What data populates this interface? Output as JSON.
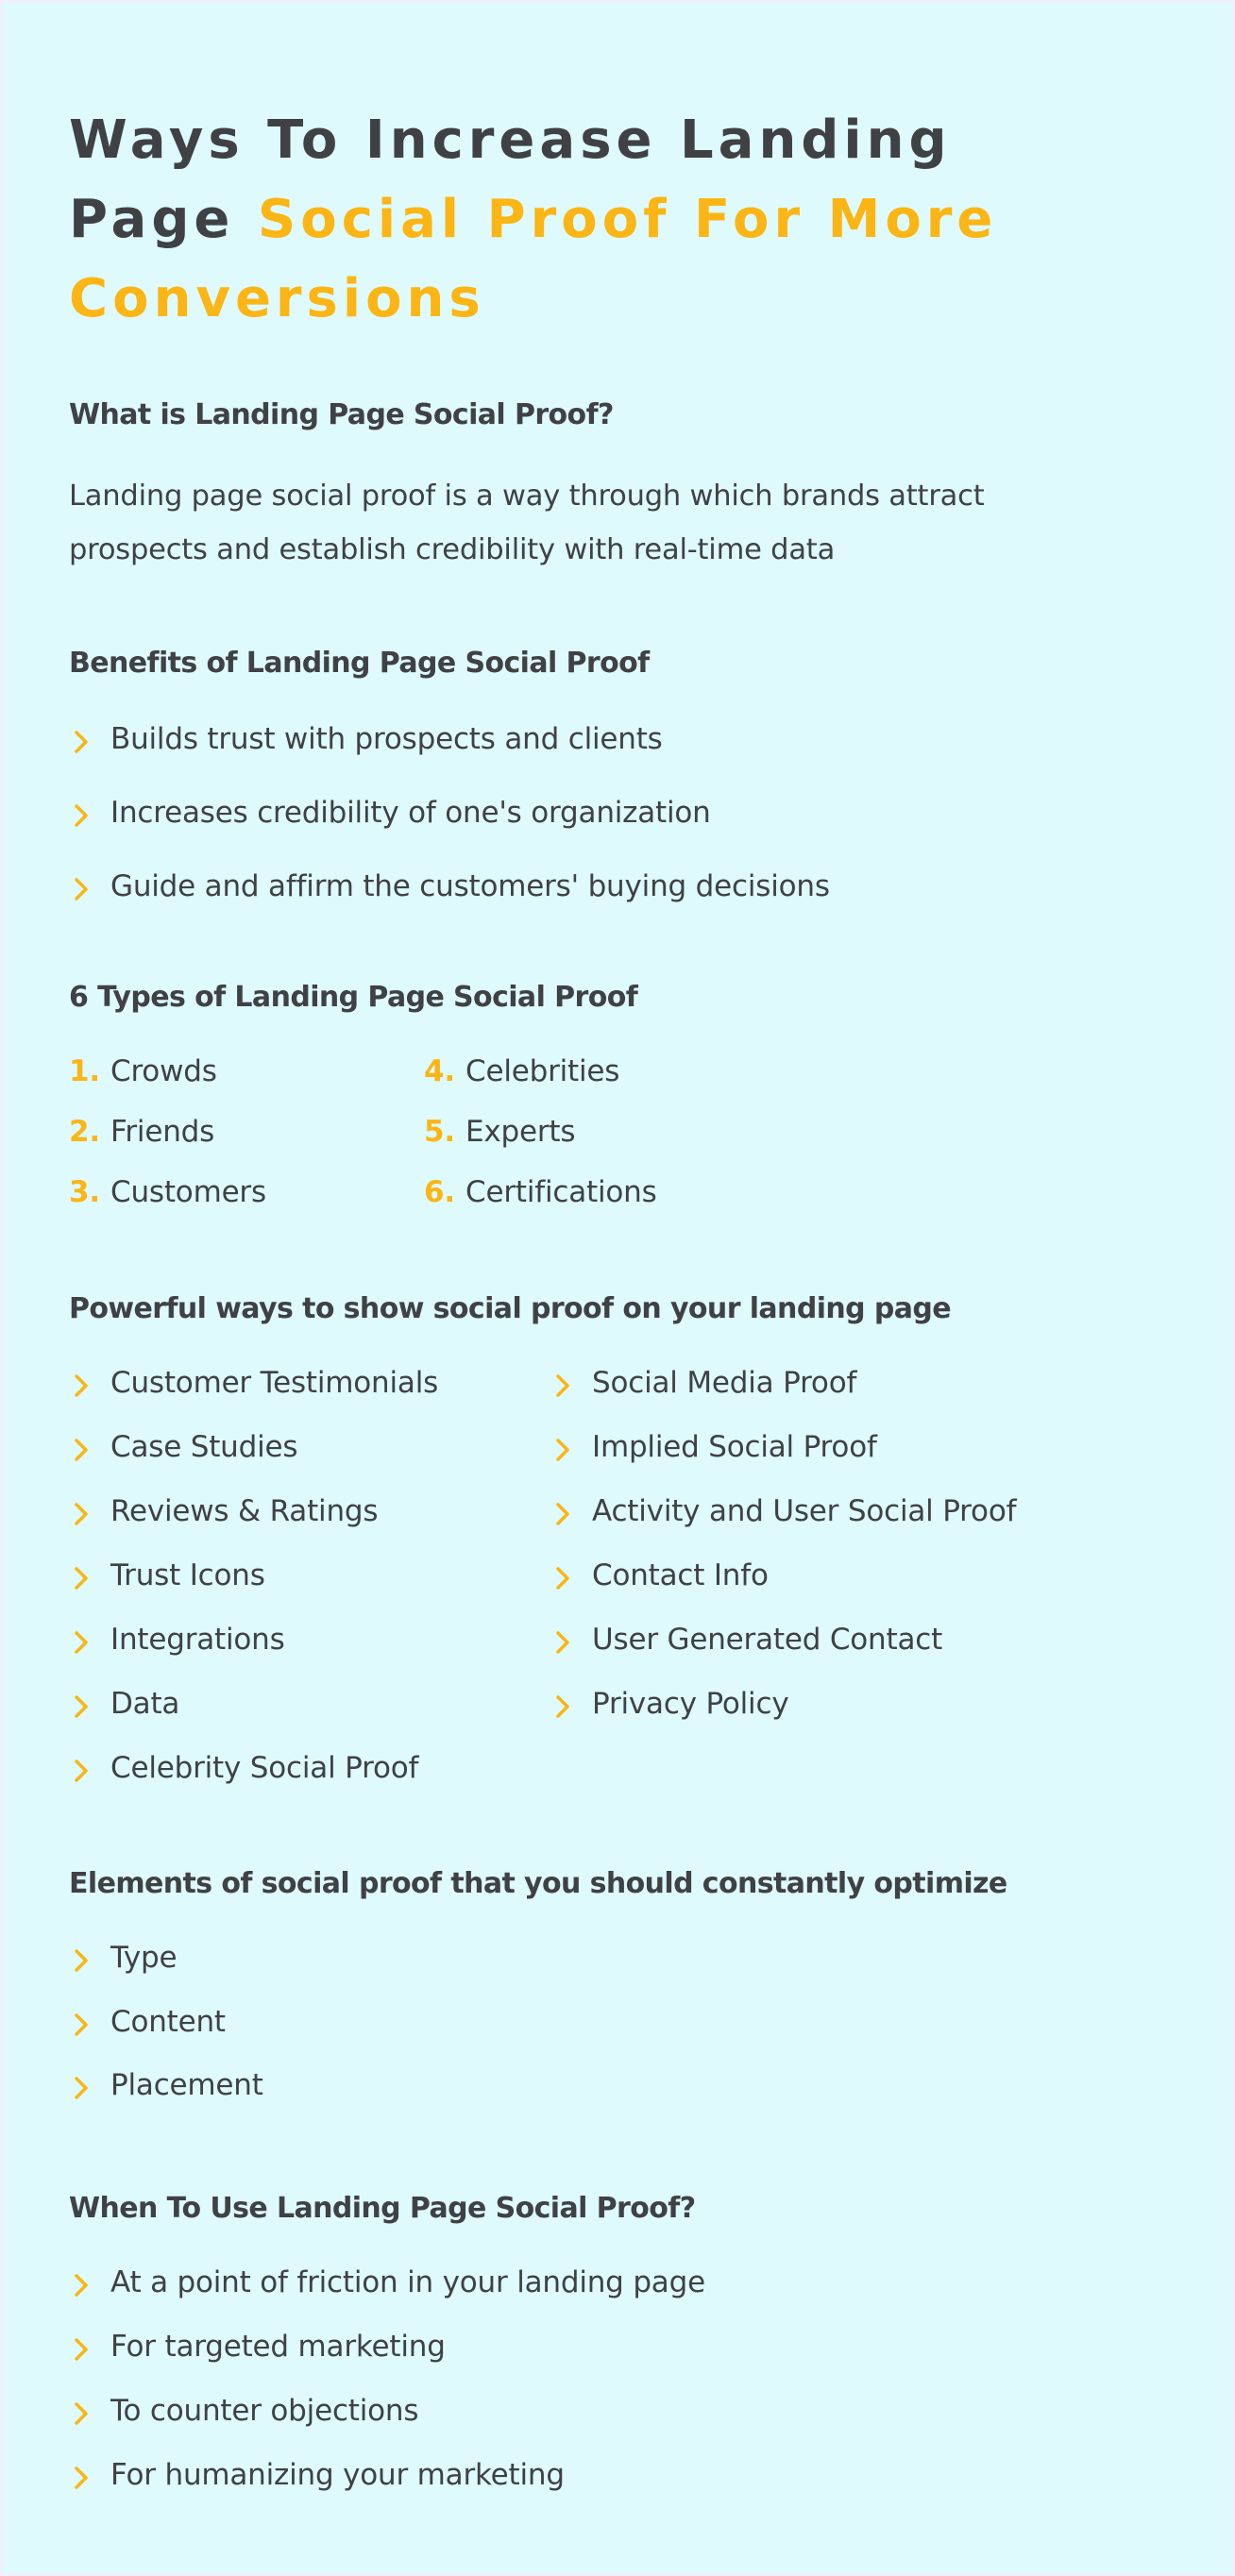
{
  "theme": {
    "accent": "#fbb514",
    "text": "#3f4145",
    "background": "#defafc"
  },
  "title": {
    "line_dark_1": "Ways To Increase Landing",
    "line_dark_2": "Page ",
    "line_accent": "Social Proof For More Conversions"
  },
  "what_is": {
    "heading": "What is Landing Page Social Proof?",
    "body": "Landing page social proof is a way through which brands attract prospects and establish credibility with real-time data"
  },
  "benefits": {
    "heading": "Benefits of Landing Page Social Proof",
    "bullet_icon": "chevron-right-icon",
    "items": [
      "Builds trust with prospects and clients",
      "Increases credibility of one's organization",
      "Guide and affirm the customers' buying decisions"
    ]
  },
  "types": {
    "heading": "6 Types of Landing Page Social Proof",
    "items": [
      {
        "number": "1.",
        "label": "Crowds"
      },
      {
        "number": "2.",
        "label": "Friends"
      },
      {
        "number": "3.",
        "label": "Customers"
      },
      {
        "number": "4.",
        "label": "Celebrities"
      },
      {
        "number": "5.",
        "label": "Experts"
      },
      {
        "number": "6.",
        "label": "Certifications"
      }
    ]
  },
  "powerful_ways": {
    "heading": "Powerful ways to show social proof on your landing page",
    "bullet_icon": "chevron-right-icon",
    "column_1": [
      "Customer Testimonials",
      "Case Studies",
      "Reviews & Ratings",
      "Trust Icons",
      "Integrations",
      "Data",
      "Celebrity Social Proof"
    ],
    "column_2": [
      "Social Media Proof",
      "Implied Social Proof",
      "Activity and User Social Proof",
      "Contact Info",
      "User Generated Contact",
      "Privacy Policy"
    ]
  },
  "elements": {
    "heading": "Elements of social proof that you should constantly optimize",
    "bullet_icon": "chevron-right-icon",
    "items": [
      "Type",
      "Content",
      "Placement"
    ]
  },
  "when_to_use": {
    "heading": "When To Use Landing Page Social Proof?",
    "bullet_icon": "chevron-right-icon",
    "items": [
      "At a point of friction in your landing page",
      "For targeted marketing",
      "To counter objections",
      "For humanizing your marketing"
    ]
  }
}
